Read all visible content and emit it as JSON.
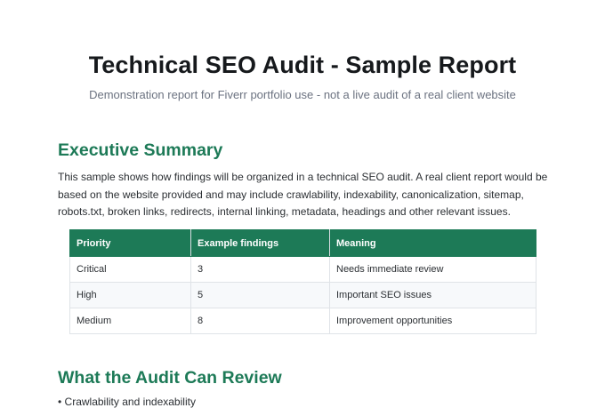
{
  "report": {
    "title": "Technical SEO Audit - Sample Report",
    "subtitle": "Demonstration report for Fiverr portfolio use - not a live audit of a real client website"
  },
  "executive_summary": {
    "heading": "Executive Summary",
    "body": "This sample shows how findings will be organized in a technical SEO audit. A real client report would be based on the website provided and may include crawlability, indexability, canonicalization, sitemap, robots.txt, broken links, redirects, internal linking, metadata, headings and other relevant issues."
  },
  "priority_table": {
    "headers": [
      "Priority",
      "Example findings",
      "Meaning"
    ],
    "rows": [
      [
        "Critical",
        "3",
        "Needs immediate review"
      ],
      [
        "High",
        "5",
        "Important SEO issues"
      ],
      [
        "Medium",
        "8",
        "Improvement opportunities"
      ]
    ]
  },
  "review_section": {
    "heading": "What the Audit Can Review",
    "items": [
      "• Crawlability and indexability"
    ]
  },
  "colors": {
    "accent": "#1d7a57",
    "title": "#16191c",
    "subtitle": "#6b7280"
  }
}
